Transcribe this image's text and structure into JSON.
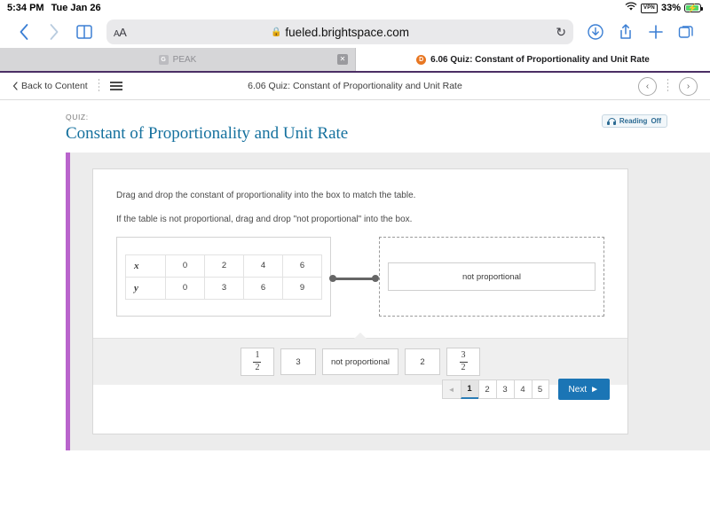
{
  "status_bar": {
    "time": "5:34 PM",
    "date": "Tue Jan 26",
    "wifi_icon": "wifi-icon",
    "vpn_badge": "VPN",
    "battery_percent": "33%",
    "battery_state": "charging"
  },
  "browser": {
    "back_icon": "chevron-left-icon",
    "forward_icon": "chevron-right-icon",
    "bookmarks_icon": "book-icon",
    "text_size_label": "AA",
    "lock_icon": "lock-icon",
    "url": "fueled.brightspace.com",
    "reload_icon": "reload-icon",
    "downloads_icon": "download-icon",
    "share_icon": "share-icon",
    "new_tab_icon": "plus-icon",
    "tabs_icon": "tabs-icon",
    "tabs": [
      {
        "title": "PEAK",
        "favicon": "G",
        "active": false,
        "close_icon": "close-icon"
      },
      {
        "title": "6.06 Quiz: Constant of Proportionality and Unit Rate",
        "favicon": "D",
        "active": true
      }
    ]
  },
  "d2l_nav": {
    "back_label": "Back to Content",
    "back_icon": "chevron-left-icon",
    "menu_icon": "hamburger-icon",
    "title": "6.06 Quiz: Constant of Proportionality and Unit Rate",
    "prev_icon": "‹",
    "next_icon": "›"
  },
  "header": {
    "kicker": "QUIZ:",
    "title": "Constant of Proportionality and Unit Rate",
    "reading": {
      "icon": "headphones-icon",
      "label": "Reading",
      "state": "Off"
    }
  },
  "question": {
    "instruction_1": "Drag and drop the constant of proportionality into the box to match the table.",
    "instruction_2": "If the table is not proportional, drag and drop \"not proportional\" into the box.",
    "table": {
      "rows": [
        {
          "label": "x",
          "values": [
            "0",
            "2",
            "4",
            "6"
          ]
        },
        {
          "label": "y",
          "values": [
            "0",
            "3",
            "6",
            "9"
          ]
        }
      ]
    },
    "dropzone": {
      "placed_answer": "not proportional"
    },
    "answer_bank": [
      {
        "type": "fraction",
        "numerator": "1",
        "denominator": "2"
      },
      {
        "type": "text",
        "label": "3"
      },
      {
        "type": "text",
        "label": "not proportional"
      },
      {
        "type": "text",
        "label": "2"
      },
      {
        "type": "fraction",
        "numerator": "3",
        "denominator": "2"
      }
    ]
  },
  "pagination": {
    "prev_icon": "◄",
    "pages": [
      "1",
      "2",
      "3",
      "4",
      "5"
    ],
    "active_page": "1",
    "next_label": "Next",
    "next_icon": "►"
  },
  "colors": {
    "accent_purple": "#b964cc",
    "brand_blue": "#1b75b5",
    "title_teal": "#15719e",
    "d2l_orange": "#e87722",
    "safari_blue": "#3b7fd4"
  }
}
